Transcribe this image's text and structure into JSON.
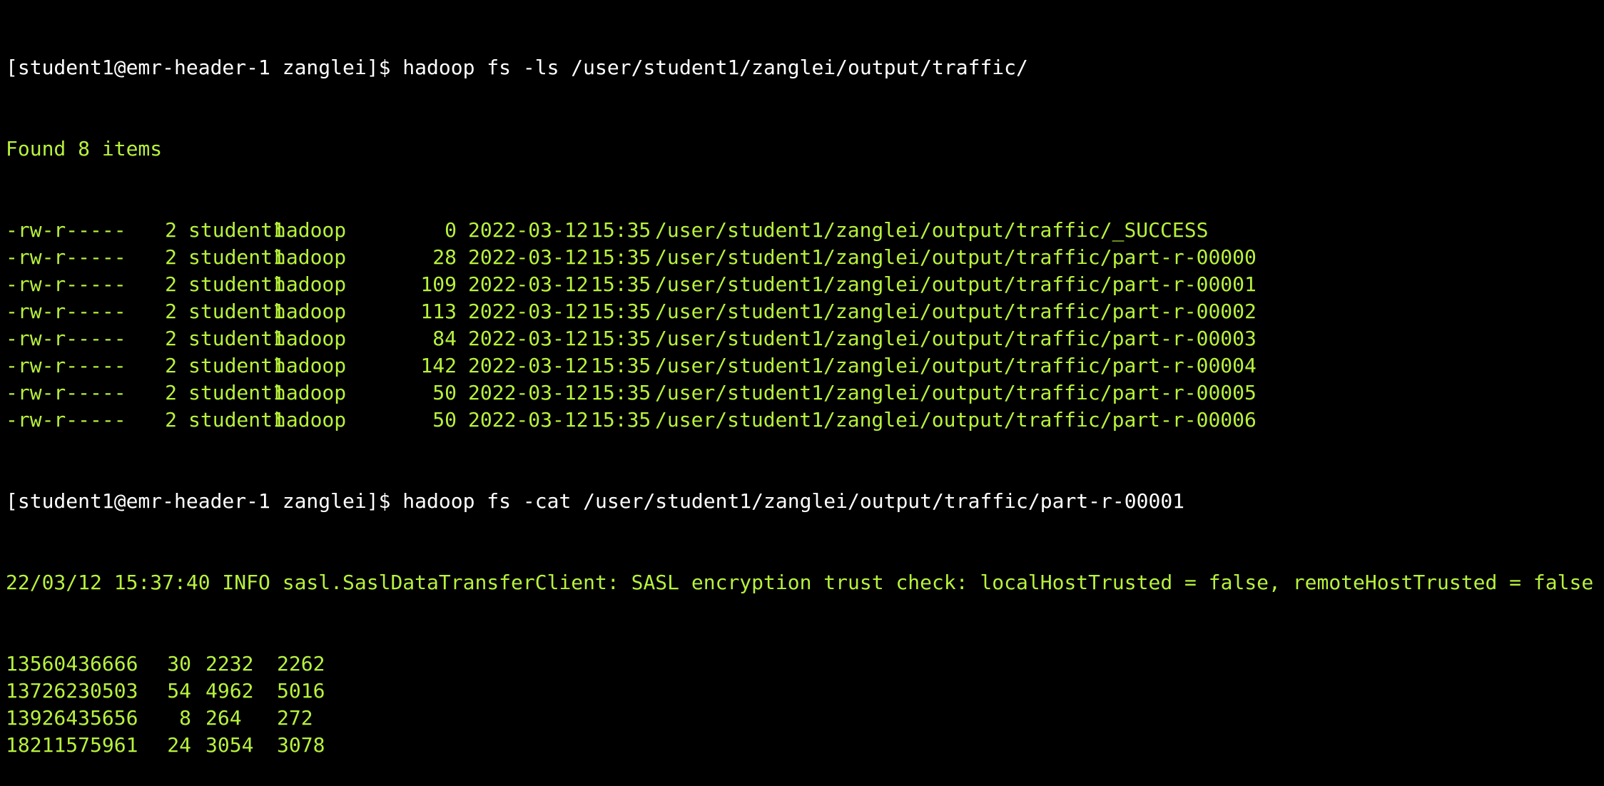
{
  "terminal": {
    "colors": {
      "background": "#000000",
      "prompt": "#ffffff",
      "output": "#b8f23c"
    },
    "cmd1": {
      "prompt": "[student1@emr-header-1 zanglei]$ ",
      "command": "hadoop fs -ls /user/student1/zanglei/output/traffic/"
    },
    "found": "Found 8 items",
    "listing": [
      {
        "perm": "-rw-r-----",
        "repl": "2",
        "owner": "student1",
        "group": "hadoop",
        "size": "0",
        "date": "2022-03-12",
        "time": "15:35",
        "path": "/user/student1/zanglei/output/traffic/_SUCCESS"
      },
      {
        "perm": "-rw-r-----",
        "repl": "2",
        "owner": "student1",
        "group": "hadoop",
        "size": "28",
        "date": "2022-03-12",
        "time": "15:35",
        "path": "/user/student1/zanglei/output/traffic/part-r-00000"
      },
      {
        "perm": "-rw-r-----",
        "repl": "2",
        "owner": "student1",
        "group": "hadoop",
        "size": "109",
        "date": "2022-03-12",
        "time": "15:35",
        "path": "/user/student1/zanglei/output/traffic/part-r-00001"
      },
      {
        "perm": "-rw-r-----",
        "repl": "2",
        "owner": "student1",
        "group": "hadoop",
        "size": "113",
        "date": "2022-03-12",
        "time": "15:35",
        "path": "/user/student1/zanglei/output/traffic/part-r-00002"
      },
      {
        "perm": "-rw-r-----",
        "repl": "2",
        "owner": "student1",
        "group": "hadoop",
        "size": "84",
        "date": "2022-03-12",
        "time": "15:35",
        "path": "/user/student1/zanglei/output/traffic/part-r-00003"
      },
      {
        "perm": "-rw-r-----",
        "repl": "2",
        "owner": "student1",
        "group": "hadoop",
        "size": "142",
        "date": "2022-03-12",
        "time": "15:35",
        "path": "/user/student1/zanglei/output/traffic/part-r-00004"
      },
      {
        "perm": "-rw-r-----",
        "repl": "2",
        "owner": "student1",
        "group": "hadoop",
        "size": "50",
        "date": "2022-03-12",
        "time": "15:35",
        "path": "/user/student1/zanglei/output/traffic/part-r-00005"
      },
      {
        "perm": "-rw-r-----",
        "repl": "2",
        "owner": "student1",
        "group": "hadoop",
        "size": "50",
        "date": "2022-03-12",
        "time": "15:35",
        "path": "/user/student1/zanglei/output/traffic/part-r-00006"
      }
    ],
    "cmd2": {
      "prompt": "[student1@emr-header-1 zanglei]$ ",
      "command": "hadoop fs -cat /user/student1/zanglei/output/traffic/part-r-00001"
    },
    "info": "22/03/12 15:37:40 INFO sasl.SaslDataTransferClient: SASL encryption trust check: localHostTrusted = false, remoteHostTrusted = false",
    "rows": [
      {
        "phone": "13560436666",
        "c2": "30",
        "c3": "2232",
        "c4": "2262"
      },
      {
        "phone": "13726230503",
        "c2": "54",
        "c3": "4962",
        "c4": "5016"
      },
      {
        "phone": "13926435656",
        "c2": "8",
        "c3": "264",
        "c4": "272"
      },
      {
        "phone": "18211575961",
        "c2": "24",
        "c3": "3054",
        "c4": "3078"
      }
    ]
  }
}
